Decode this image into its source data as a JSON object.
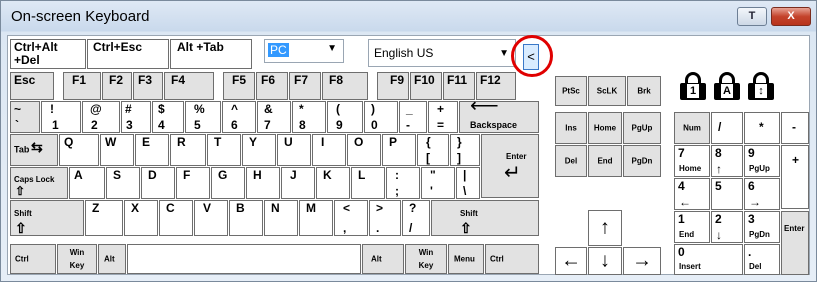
{
  "window": {
    "title": "On-screen Keyboard",
    "btn_help": "T",
    "btn_close": "X"
  },
  "toolbar": {
    "b1": [
      "Ctrl+Alt",
      "+Del"
    ],
    "b2": "Ctrl+Esc",
    "b3": "Alt +Tab",
    "mode_select": "PC",
    "language_select": "English US",
    "collapse": "<"
  },
  "rows": {
    "r1": [
      "Esc",
      "F1",
      "F2",
      "F3",
      "F4",
      "F5",
      "F6",
      "F7",
      "F8",
      "F9",
      "F10",
      "F11",
      "F12"
    ],
    "r2": [
      [
        "~",
        "`"
      ],
      [
        "!",
        "1"
      ],
      [
        "@",
        "2"
      ],
      [
        "#",
        "3"
      ],
      [
        "$",
        "4"
      ],
      [
        "%",
        "5"
      ],
      [
        "^",
        "6"
      ],
      [
        "&",
        "7"
      ],
      [
        "*",
        "8"
      ],
      [
        "(",
        "9"
      ],
      [
        ")",
        "0"
      ],
      [
        "_",
        "-"
      ],
      [
        "+",
        "="
      ],
      "Backspace"
    ],
    "r3": [
      "Tab",
      "Q",
      "W",
      "E",
      "R",
      "T",
      "Y",
      "U",
      "I",
      "O",
      "P",
      [
        "{",
        "["
      ],
      [
        "}",
        "]"
      ],
      "Enter"
    ],
    "r4": [
      "Caps Lock",
      "A",
      "S",
      "D",
      "F",
      "G",
      "H",
      "J",
      "K",
      "L",
      [
        ":",
        ";"
      ],
      [
        "\"",
        "'"
      ],
      [
        "|",
        "\\"
      ]
    ],
    "r5": [
      "Shift",
      "Z",
      "X",
      "C",
      "V",
      "B",
      "N",
      "M",
      [
        "<",
        ","
      ],
      [
        ">",
        "."
      ],
      [
        "?",
        "/"
      ],
      "Shift"
    ],
    "r6": [
      "Ctrl",
      "Win Key",
      "Alt",
      "Alt",
      "Win Key",
      "Menu",
      "Ctrl"
    ]
  },
  "nav": {
    "top": [
      "PtSc",
      "ScLK",
      "Brk"
    ],
    "row2": [
      "Ins",
      "Home",
      "PgUp"
    ],
    "row3": [
      "Del",
      "End",
      "PgDn"
    ]
  },
  "numpad": {
    "row1": [
      "Num",
      "/",
      "*",
      "-"
    ],
    "row2": [
      [
        "7",
        "Home"
      ],
      [
        "8",
        ""
      ],
      [
        "9",
        "PgUp"
      ],
      "+"
    ],
    "row3": [
      [
        "4",
        ""
      ],
      [
        "5",
        ""
      ],
      [
        "6",
        ""
      ]
    ],
    "row4": [
      [
        "1",
        "End"
      ],
      [
        "2",
        ""
      ],
      [
        "3",
        "PgDn"
      ],
      "Enter"
    ],
    "row5": [
      [
        "0",
        "Insert"
      ],
      [
        ".",
        "Del"
      ]
    ]
  },
  "locks": [
    "1",
    "A",
    "↕"
  ]
}
